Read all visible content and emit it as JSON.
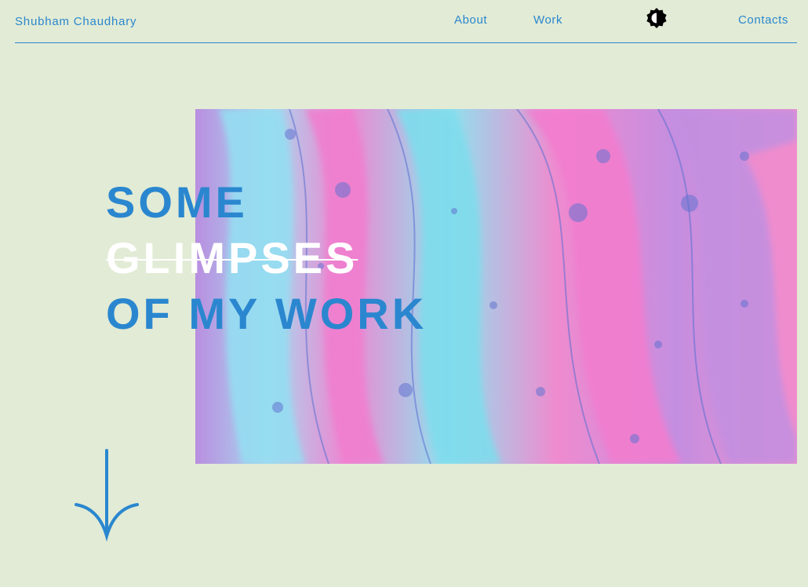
{
  "header": {
    "brand": "Shubham Chaudhary",
    "nav": {
      "about": "About",
      "work": "Work",
      "contacts": "Contacts"
    },
    "theme_icon": "half-contrast-icon"
  },
  "hero": {
    "line1": "SOME",
    "line2": "GLIMPSES",
    "line3": "OF MY WORK",
    "art": "fluid-marble-art",
    "scroll_icon": "arrow-down-icon"
  },
  "colors": {
    "background": "#e2ebd5",
    "accent": "#2a87cf",
    "strike": "#ffffff"
  }
}
